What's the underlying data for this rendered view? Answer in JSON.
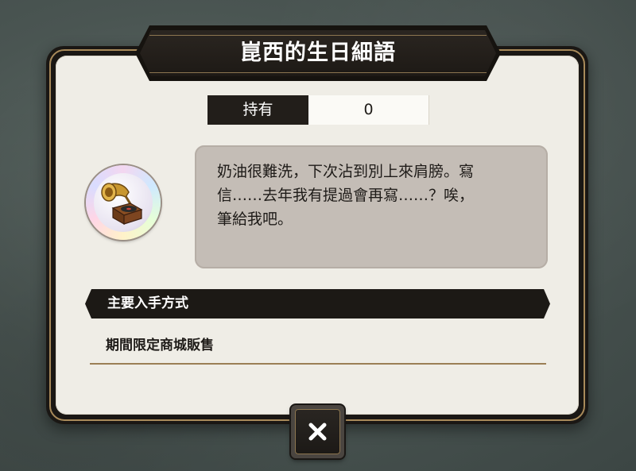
{
  "title": "崑西的生日細語",
  "owned": {
    "label": "持有",
    "value": "0"
  },
  "item": {
    "icon": "gramophone-icon"
  },
  "description": "奶油很難洗，下次沾到別上來肩膀。寫\n信……去年我有提過會再寫……？唉，\n筆給我吧。",
  "acquisition": {
    "header": "主要入手方式",
    "methods": [
      "期間限定商城販售"
    ]
  },
  "close": {
    "icon": "close-icon"
  },
  "colors": {
    "accent_gold": "#a88a5a",
    "panel_bg": "#efede6",
    "desc_bg": "#c4bdb6",
    "dark": "#1c1915"
  }
}
